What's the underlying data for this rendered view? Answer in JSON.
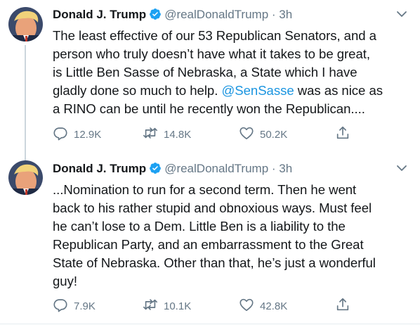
{
  "tweets": [
    {
      "name": "Donald J. Trump",
      "handle": "@realDonaldTrump",
      "sep": "·",
      "time": "3h",
      "text_lines": [
        "The least effective of our 53 Republican Senators, and a",
        "person who truly doesn’t have what it takes to be great,",
        "is Little Ben Sasse of Nebraska, a State which I have",
        "gladly done so much to help."
      ],
      "mention": "@SenSasse",
      "text_after_mention": " was as nice as",
      "text_last": "a RINO can be until he recently won the Republican....",
      "replies": "12.9K",
      "retweets": "14.8K",
      "likes": "50.2K"
    },
    {
      "name": "Donald J. Trump",
      "handle": "@realDonaldTrump",
      "sep": "·",
      "time": "3h",
      "text_lines": [
        "...Nomination to run for a second term. Then he went",
        "back to his rather stupid and obnoxious ways. Must feel",
        "he can’t lose to a Dem. Little Ben is a liability to the",
        "Republican Party, and an embarrassment to the Great",
        "State of Nebraska. Other than that, he’s just a wonderful",
        "guy!"
      ],
      "replies": "7.9K",
      "retweets": "10.1K",
      "likes": "42.8K"
    }
  ],
  "colors": {
    "link": "#1b95e0",
    "verified": "#1da1f2",
    "muted": "#657786",
    "text": "#14171a"
  },
  "icons": [
    "avatar",
    "verified-badge-icon",
    "chevron-down-icon",
    "reply-icon",
    "retweet-icon",
    "like-icon",
    "share-icon"
  ]
}
